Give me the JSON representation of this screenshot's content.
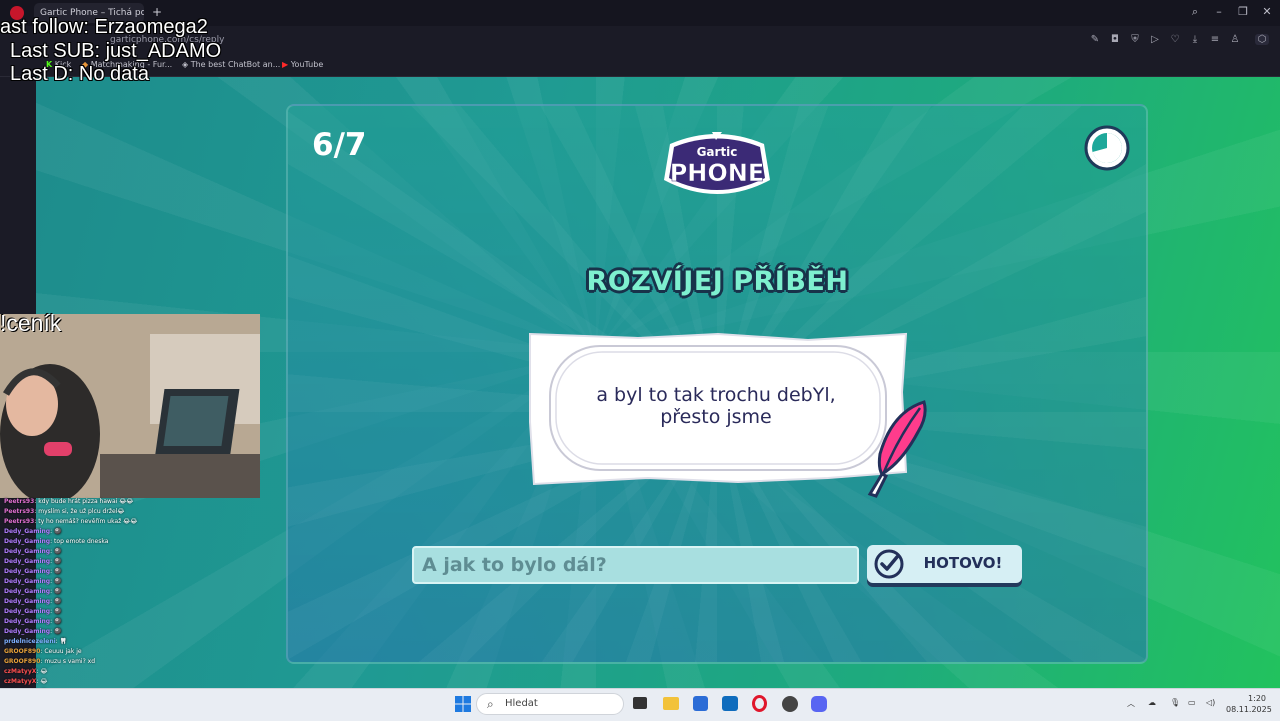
{
  "browser": {
    "tab_title": "Gartic Phone – Tichá pošt",
    "new_tab": "+",
    "url": "garticphone.com/cs/reply",
    "bookmarks": [
      "Kick",
      "Matchmaking - Fur...",
      "The best ChatBot an...",
      "YouTube"
    ]
  },
  "overlay": {
    "last_follow": "ast follow: Erzaomega2",
    "last_sub": "Last SUB: just_ADAMO",
    "last_d": "Last D: No data",
    "cenik": "!ceník"
  },
  "game": {
    "round": "6/7",
    "logo_top": "Gartic",
    "logo_bottom": "PHONE",
    "heading": "ROZVÍJEJ PŘÍBĚH",
    "story_line1": "a byl to tak trochu debYl,",
    "story_line2": "přesto jsme",
    "input_placeholder": "A jak to bylo dál?",
    "done_label": "HOTOVO!"
  },
  "chat": [
    {
      "user": "Peetrs93",
      "msg": "kdy bude hrát pizza hawai 😂😂",
      "color": "#e070d0"
    },
    {
      "user": "Peetrs93",
      "msg": "myslím si, že už plcu držel😂",
      "color": "#e070d0"
    },
    {
      "user": "Peetrs93",
      "msg": "ty ho nemáš? nevěřím ukaž 😂😂",
      "color": "#e070d0"
    },
    {
      "user": "Dedy_Gaming",
      "msg": "🎱",
      "color": "#b07cff"
    },
    {
      "user": "Dedy_Gaming",
      "msg": "top emote dneska",
      "color": "#b07cff"
    },
    {
      "user": "Dedy_Gaming",
      "msg": "🎱",
      "color": "#b07cff"
    },
    {
      "user": "Dedy_Gaming",
      "msg": "🎱",
      "color": "#b07cff"
    },
    {
      "user": "Dedy_Gaming",
      "msg": "🎱",
      "color": "#b07cff"
    },
    {
      "user": "Dedy_Gaming",
      "msg": "🎱",
      "color": "#b07cff"
    },
    {
      "user": "Dedy_Gaming",
      "msg": "🎱",
      "color": "#b07cff"
    },
    {
      "user": "Dedy_Gaming",
      "msg": "🎱",
      "color": "#b07cff"
    },
    {
      "user": "Dedy_Gaming",
      "msg": "🎱",
      "color": "#b07cff"
    },
    {
      "user": "Dedy_Gaming",
      "msg": "🎱",
      "color": "#b07cff"
    },
    {
      "user": "Dedy_Gaming",
      "msg": "🎱",
      "color": "#b07cff"
    },
    {
      "user": "prdelnicezeleni",
      "msg": "🦷",
      "color": "#7fb0ff"
    },
    {
      "user": "GROOF890",
      "msg": "Ceuuu jak je",
      "color": "#e8a23a"
    },
    {
      "user": "GROOF890",
      "msg": "muzu s vami? xd",
      "color": "#e8a23a"
    },
    {
      "user": "czMatyyX",
      "msg": "😂",
      "color": "#ff5050"
    },
    {
      "user": "czMatyyX",
      "msg": "😂",
      "color": "#ff5050"
    },
    {
      "user": "czMatyyX",
      "msg": "😂",
      "color": "#ff5050"
    },
    {
      "user": "czMatyyX",
      "msg": "😂",
      "color": "#ff5050"
    },
    {
      "user": "czMatyyX",
      "msg": "😂",
      "color": "#ff5050"
    }
  ],
  "taskbar": {
    "search_placeholder": "Hledat",
    "time": "1:20",
    "date": "08.11.2025"
  },
  "icons": {
    "start": "windows-start-icon",
    "timer": "timer-icon",
    "quill": "quill-icon",
    "check": "check-icon"
  }
}
